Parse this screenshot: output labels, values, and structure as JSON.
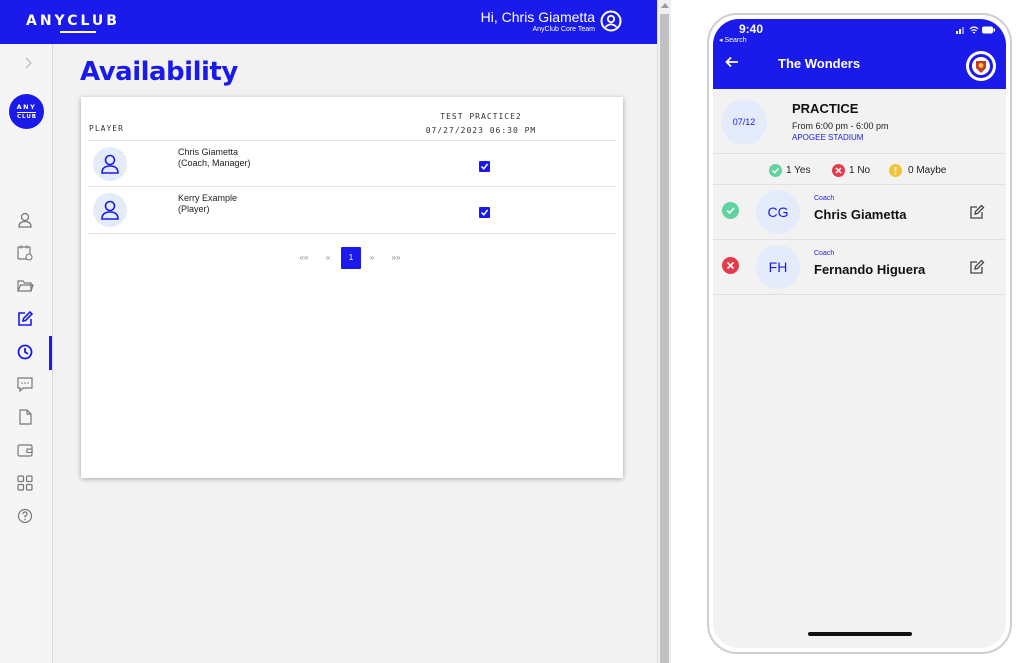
{
  "web": {
    "brand": "ANYCLUB",
    "header": {
      "greeting": "Hi, Chris Giametta",
      "team": "AnyClub Core Team"
    },
    "sidebar": {
      "logo_top": "ANY",
      "logo_bottom": "CLUB",
      "items": [
        {
          "icon": "user-icon"
        },
        {
          "icon": "calendar-icon"
        },
        {
          "icon": "folder-icon"
        },
        {
          "icon": "edit-icon"
        },
        {
          "icon": "clock-icon",
          "active": true
        },
        {
          "icon": "chat-icon"
        },
        {
          "icon": "document-icon"
        },
        {
          "icon": "wallet-icon"
        },
        {
          "icon": "grid-icon"
        },
        {
          "icon": "help-icon"
        }
      ]
    },
    "page_title": "Availability",
    "table": {
      "player_header": "PLAYER",
      "event_name": "TEST PRACTICE2",
      "event_datetime": "07/27/2023 06:30 PM",
      "rows": [
        {
          "name": "Chris Giametta",
          "role": "(Coach, Manager)",
          "checked": true
        },
        {
          "name": "Kerry Example",
          "role": "(Player)",
          "checked": true
        }
      ]
    },
    "pager": {
      "first": "««",
      "prev": "«",
      "current": "1",
      "next": "»",
      "last": "»»"
    },
    "colors": {
      "accent": "#1a1aeb",
      "avatar_bg": "#e4ecfc"
    }
  },
  "phone": {
    "status": {
      "time": "9:40",
      "back_app": "◂ Search"
    },
    "team_name": "The Wonders",
    "event": {
      "date": "07/12",
      "type": "PRACTICE",
      "time": "From 6:00 pm - 6:00 pm",
      "location": "APOGEE STADIUM"
    },
    "summary": {
      "yes": "1 Yes",
      "no": "1 No",
      "maybe": "0 Maybe"
    },
    "members": [
      {
        "initials": "CG",
        "role": "Coach",
        "name": "Chris Giametta",
        "status": "yes"
      },
      {
        "initials": "FH",
        "role": "Coach",
        "name": "Fernando Higuera",
        "status": "no"
      }
    ],
    "colors": {
      "yes": "#5fd4a0",
      "no": "#e53a4a",
      "maybe": "#f2c43a"
    }
  }
}
